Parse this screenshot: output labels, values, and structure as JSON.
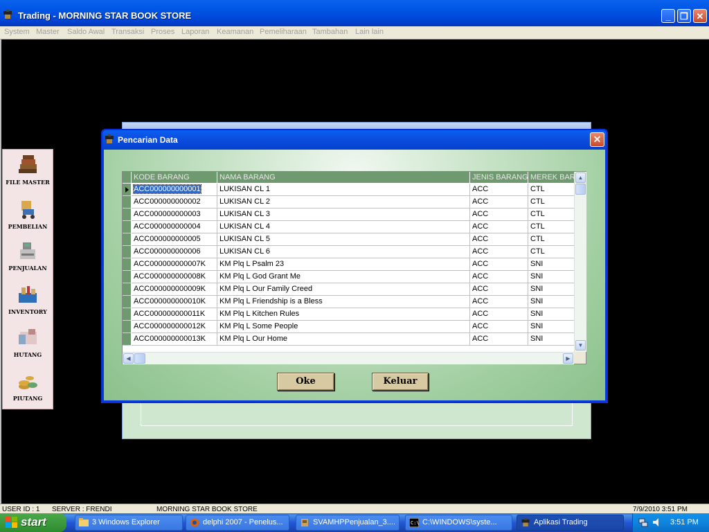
{
  "window": {
    "title": "Trading - MORNING STAR BOOK STORE"
  },
  "menu": [
    "System",
    "Master",
    "Saldo Awal",
    "Transaksi",
    "Proses",
    "Laporan",
    "Keamanan",
    "Pemeliharaan",
    "Tambahan",
    "Lain lain"
  ],
  "tools": [
    "FILE MASTER",
    "PEMBELIAN",
    "PENJUALAN",
    "INVENTORY",
    "HUTANG",
    "PIUTANG"
  ],
  "dialog": {
    "title": "Pencarian Data",
    "columns": [
      "KODE BARANG",
      "NAMA BARANG",
      "JENIS BARANG",
      "MEREK BAR"
    ],
    "rows": [
      [
        "ACC000000000001",
        "LUKISAN CL 1",
        "ACC",
        "CTL"
      ],
      [
        "ACC000000000002",
        "LUKISAN CL 2",
        "ACC",
        "CTL"
      ],
      [
        "ACC000000000003",
        "LUKISAN CL 3",
        "ACC",
        "CTL"
      ],
      [
        "ACC000000000004",
        "LUKISAN CL 4",
        "ACC",
        "CTL"
      ],
      [
        "ACC000000000005",
        "LUKISAN CL 5",
        "ACC",
        "CTL"
      ],
      [
        "ACC000000000006",
        "LUKISAN CL 6",
        "ACC",
        "CTL"
      ],
      [
        "ACC000000000007K",
        "KM Plq L Psalm 23",
        "ACC",
        "SNI"
      ],
      [
        "ACC000000000008K",
        "KM Plq L God Grant Me",
        "ACC",
        "SNI"
      ],
      [
        "ACC000000000009K",
        "KM Plq L Our Family Creed",
        "ACC",
        "SNI"
      ],
      [
        "ACC000000000010K",
        "KM Plq L Friendship is a Bless",
        "ACC",
        "SNI"
      ],
      [
        "ACC000000000011K",
        "KM Plq L Kitchen Rules",
        "ACC",
        "SNI"
      ],
      [
        "ACC000000000012K",
        "KM Plq L Some People",
        "ACC",
        "SNI"
      ],
      [
        "ACC000000000013K",
        "KM Plq L Our Home",
        "ACC",
        "SNI"
      ]
    ],
    "ok_label": "Oke",
    "exit_label": "Keluar"
  },
  "statusbar": {
    "user": "USER ID : 1",
    "server": "SERVER : FRENDI",
    "company": "MORNING STAR BOOK STORE",
    "datetime": "7/9/2010 3:51 PM"
  },
  "taskbar": {
    "start_label": "start",
    "tasks": [
      "3 Windows Explorer",
      "delphi 2007 - Penelus...",
      "SVAMHPPenjualan_3....",
      "C:\\WINDOWS\\syste...",
      "Aplikasi Trading"
    ],
    "clock": "3:51 PM"
  },
  "colors": {
    "titlebar": "#0054e3",
    "grid_header": "#6f9a6f",
    "dialog_bg": "#cfe7cf",
    "selection": "#316ac5",
    "taskbar": "#245edb",
    "start_green": "#3c9a3c"
  }
}
